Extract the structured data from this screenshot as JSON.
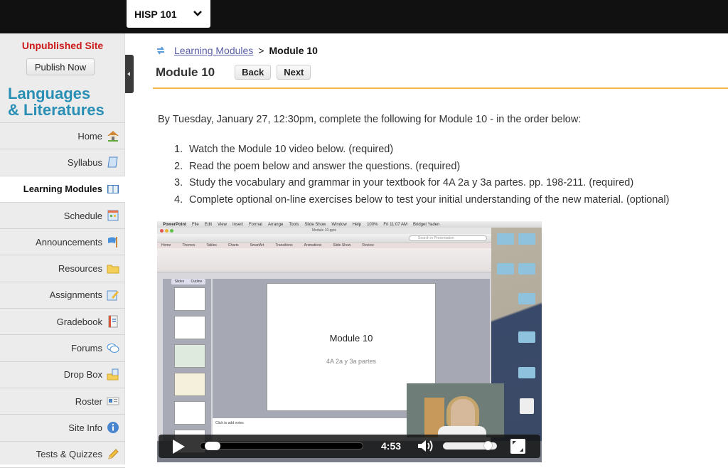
{
  "topbar": {
    "site_name": "HISP 101"
  },
  "sidebar": {
    "status": "Unpublished Site",
    "publish_label": "Publish Now",
    "brand_line1": "Languages",
    "brand_line2": "& Literatures",
    "items": [
      {
        "label": "Home",
        "icon": "home-icon",
        "active": false
      },
      {
        "label": "Syllabus",
        "icon": "syllabus-icon",
        "active": false
      },
      {
        "label": "Learning Modules",
        "icon": "book-icon",
        "active": true
      },
      {
        "label": "Schedule",
        "icon": "calendar-icon",
        "active": false
      },
      {
        "label": "Announcements",
        "icon": "flag-icon",
        "active": false
      },
      {
        "label": "Resources",
        "icon": "folder-icon",
        "active": false
      },
      {
        "label": "Assignments",
        "icon": "edit-icon",
        "active": false
      },
      {
        "label": "Gradebook",
        "icon": "gradebook-icon",
        "active": false
      },
      {
        "label": "Forums",
        "icon": "chat-icon",
        "active": false
      },
      {
        "label": "Drop Box",
        "icon": "dropbox-icon",
        "active": false
      },
      {
        "label": "Roster",
        "icon": "roster-icon",
        "active": false
      },
      {
        "label": "Site Info",
        "icon": "info-icon",
        "active": false
      },
      {
        "label": "Tests & Quizzes",
        "icon": "pencil-icon",
        "active": false
      }
    ]
  },
  "breadcrumb": {
    "parent": "Learning Modules",
    "separator": ">",
    "current": "Module 10"
  },
  "page": {
    "title": "Module 10",
    "back_label": "Back",
    "next_label": "Next",
    "intro": "By Tuesday, January 27, 12:30pm, complete the following for Module 10 - in the order below:",
    "tasks": [
      {
        "num": "1.",
        "text": "Watch the Module 10 video below. (required)"
      },
      {
        "num": "2.",
        "text": "Read the poem below and answer the questions.  (required)"
      },
      {
        "num": "3.",
        "text": "Study the vocabulary and grammar in your textbook for 4A 2a y 3a partes.  pp. 198-211. (required)"
      },
      {
        "num": "4.",
        "text": "Complete optional on-line exercises below to test your initial understanding of the new material.  (optional)"
      }
    ]
  },
  "video": {
    "menubar": [
      "PowerPoint",
      "File",
      "Edit",
      "View",
      "Insert",
      "Format",
      "Arrange",
      "Tools",
      "Slide Show",
      "Window",
      "Help",
      "100%",
      "Fri 11:07 AM",
      "Bridget Yaden"
    ],
    "file_name": "Module 10.pptx",
    "search_placeholder": "Search in Presentation",
    "ribbon_tabs": [
      "Home",
      "Themes",
      "Tables",
      "Charts",
      "SmartArt",
      "Transitions",
      "Animations",
      "Slide Show",
      "Review"
    ],
    "slide_tabs": [
      "Slides",
      "Outline"
    ],
    "slide_title": "Module 10",
    "slide_subtitle": "4A 2a y 3a partes",
    "notes_placeholder": "Click to add notes",
    "time": "4:53",
    "progress": 0.03,
    "volume": 0.9
  }
}
